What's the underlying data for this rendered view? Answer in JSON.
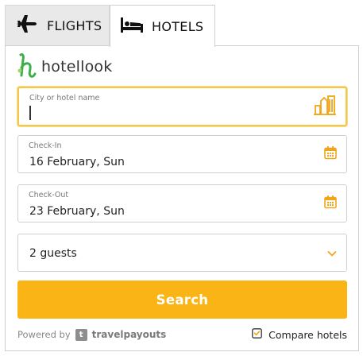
{
  "tabs": [
    {
      "label": "FLIGHTS",
      "icon": "airplane-icon",
      "active": false
    },
    {
      "label": "HOTELS",
      "icon": "bed-icon",
      "active": true
    }
  ],
  "brand": {
    "name": "hotellook",
    "accent": "#3fae49"
  },
  "city": {
    "label": "City or hotel name",
    "value": ""
  },
  "checkin": {
    "label": "Check-In",
    "value": "16 February, Sun"
  },
  "checkout": {
    "label": "Check-Out",
    "value": "23 February, Sun"
  },
  "guests": {
    "value": "2 guests"
  },
  "search": {
    "label": "Search",
    "color": "#fbb416"
  },
  "footer": {
    "powered_by": "Powered by",
    "partner": "travelpayouts",
    "partner_logo_letter": "t",
    "compare_label": "Compare hotels"
  },
  "colors": {
    "accent": "#fbb416",
    "focus_border": "#f4c64a",
    "icon": "#f1a51a"
  }
}
